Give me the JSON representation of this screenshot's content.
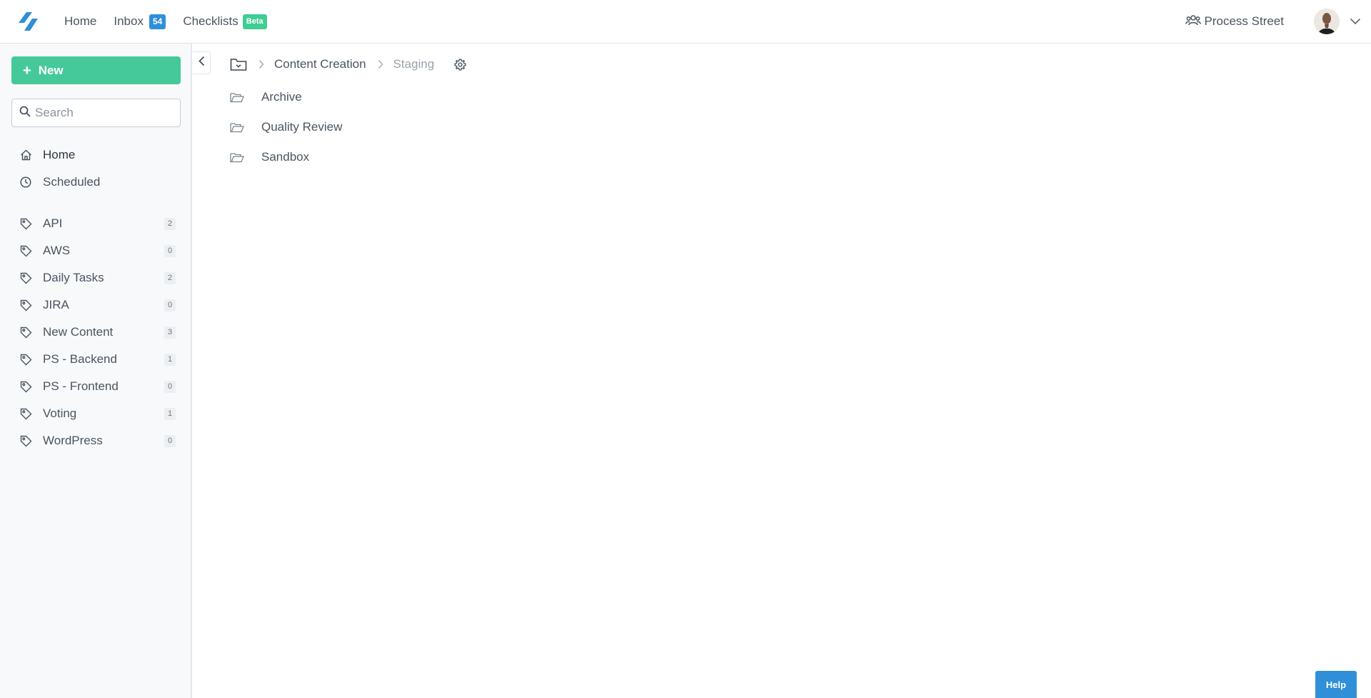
{
  "topbar": {
    "nav": {
      "home": "Home",
      "inbox": "Inbox",
      "inbox_count": "54",
      "checklists": "Checklists",
      "checklists_badge": "Beta"
    },
    "org_name": "Process Street"
  },
  "sidebar": {
    "new_label": "New",
    "search_placeholder": "Search",
    "main_items": [
      {
        "label": "Home",
        "icon": "home-icon"
      },
      {
        "label": "Scheduled",
        "icon": "clock-icon"
      }
    ],
    "tags": [
      {
        "label": "API",
        "count": "2"
      },
      {
        "label": "AWS",
        "count": "0"
      },
      {
        "label": "Daily Tasks",
        "count": "2"
      },
      {
        "label": "JIRA",
        "count": "0"
      },
      {
        "label": "New Content",
        "count": "3"
      },
      {
        "label": "PS - Backend",
        "count": "1"
      },
      {
        "label": "PS - Frontend",
        "count": "0"
      },
      {
        "label": "Voting",
        "count": "1"
      },
      {
        "label": "WordPress",
        "count": "0"
      }
    ]
  },
  "breadcrumb": {
    "parent": "Content Creation",
    "current": "Staging"
  },
  "folders": [
    {
      "label": "Archive"
    },
    {
      "label": "Quality Review"
    },
    {
      "label": "Sandbox"
    }
  ],
  "help_label": "Help",
  "colors": {
    "accent_green": "#45c99a",
    "accent_blue": "#2f8fd8",
    "beta_green": "#3fcd93"
  }
}
